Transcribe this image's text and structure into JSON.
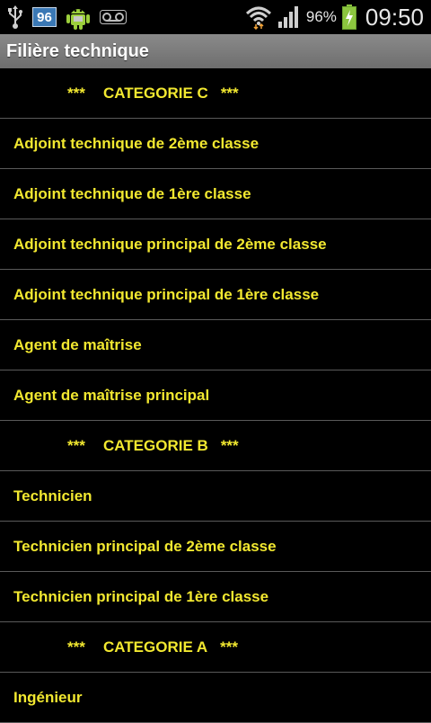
{
  "status_bar": {
    "badge_text": "96",
    "battery_percent": "96%",
    "time": "09:50",
    "icons": [
      "usb-icon",
      "badge-96-icon",
      "android-icon",
      "voicemail-icon",
      "wifi-icon",
      "signal-icon",
      "battery-charging-icon"
    ]
  },
  "title_bar": {
    "title": "Filière technique"
  },
  "list": {
    "header_c": {
      "stars_left": "***",
      "label": "CATEGORIE C",
      "stars_right": "***"
    },
    "items_c": [
      "Adjoint technique de 2ème classe",
      "Adjoint technique de 1ère classe",
      "Adjoint technique principal de 2ème classe",
      "Adjoint technique principal de 1ère classe",
      "Agent de maîtrise",
      "Agent de maîtrise principal"
    ],
    "header_b": {
      "stars_left": "***",
      "label": "CATEGORIE B",
      "stars_right": "***"
    },
    "items_b": [
      "Technicien",
      "Technicien principal de 2ème classe",
      "Technicien principal de 1ère classe"
    ],
    "header_a": {
      "stars_left": "***",
      "label": "CATEGORIE A",
      "stars_right": "***"
    },
    "items_a": [
      "Ingénieur"
    ]
  },
  "colors": {
    "text_yellow": "#f2e830",
    "divider": "#5a5a5a",
    "background": "#000000",
    "title_bar": "#7c7c7c",
    "battery_green": "#8cc63f"
  }
}
